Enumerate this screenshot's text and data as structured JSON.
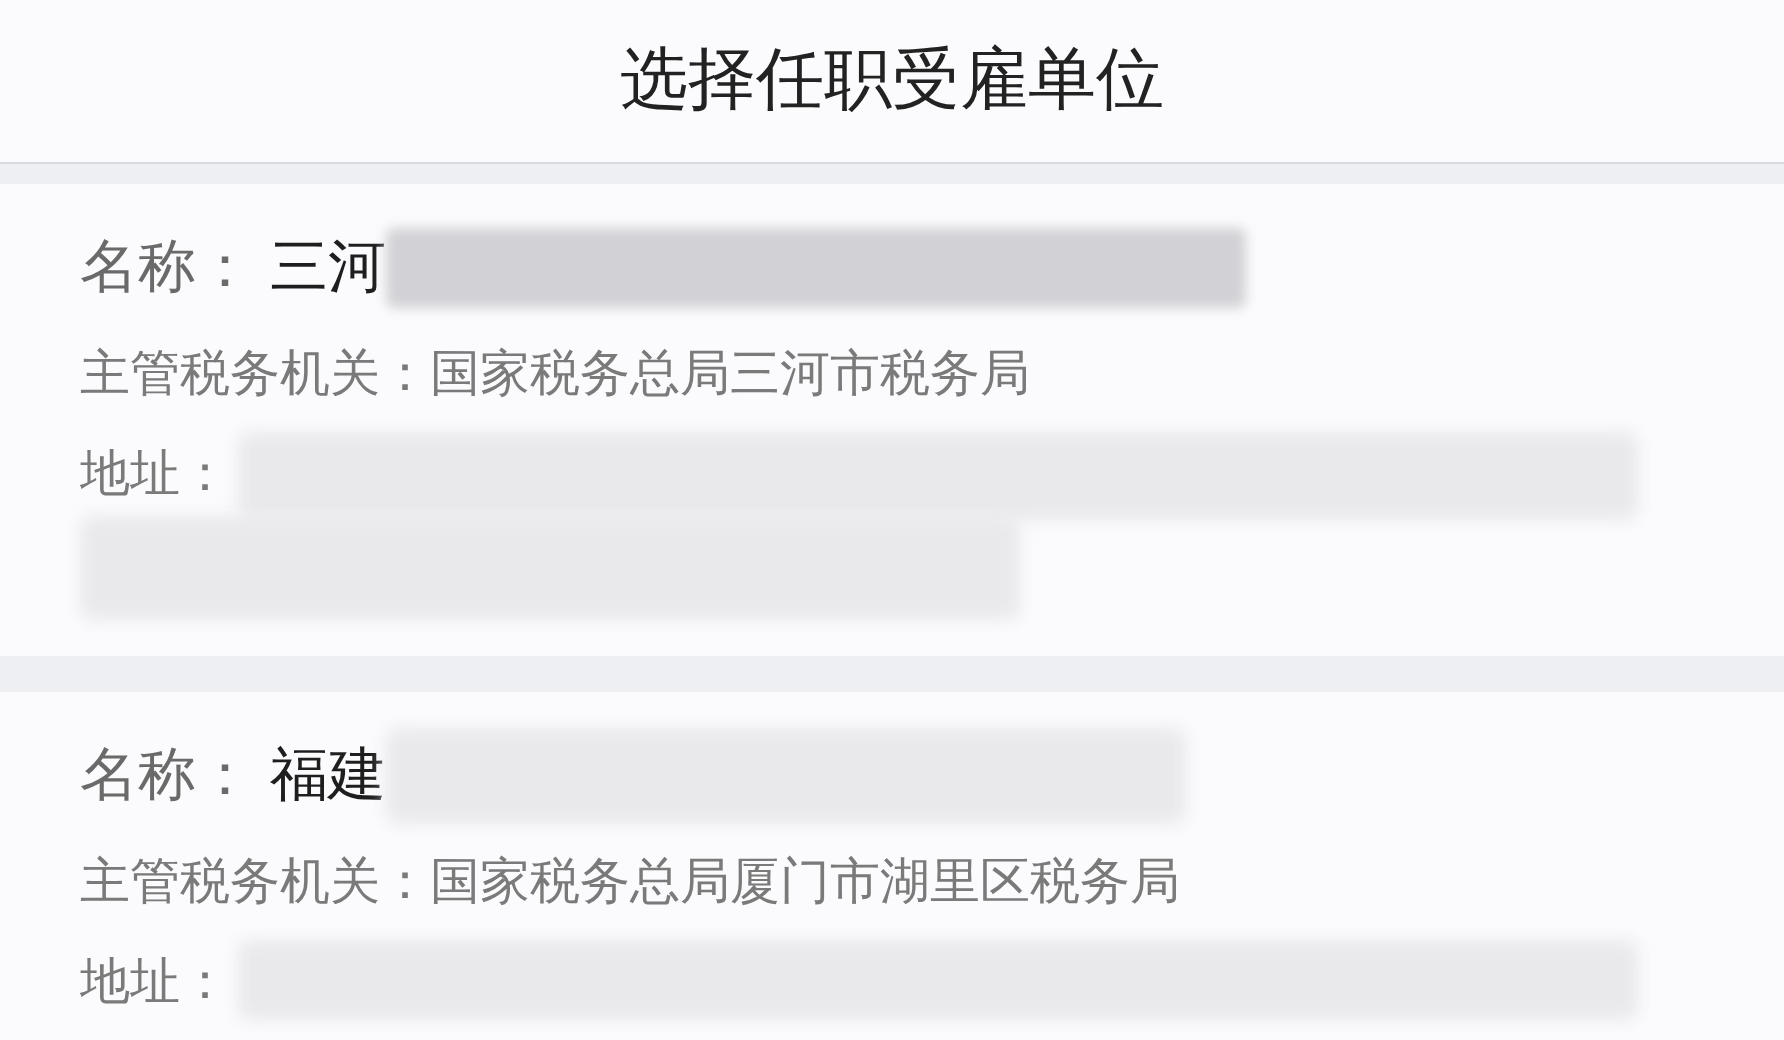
{
  "header": {
    "title": "选择任职受雇单位"
  },
  "employers": [
    {
      "name_label": "名称：",
      "name": "三河",
      "authority_label": "主管税务机关：",
      "authority": "国家税务总局三河市税务局",
      "address_label": "地址："
    },
    {
      "name_label": "名称：",
      "name": "福建",
      "authority_label": "主管税务机关：",
      "authority": "国家税务总局厦门市湖里区税务局",
      "address_label": "地址："
    }
  ]
}
